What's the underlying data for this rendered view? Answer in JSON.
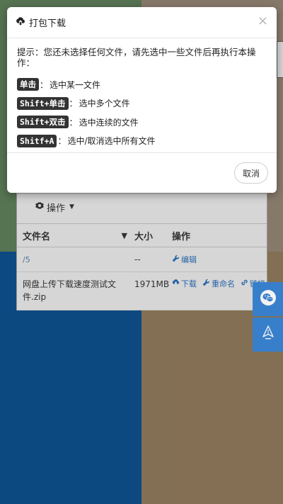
{
  "modal": {
    "title": "打包下载",
    "close_label": "×",
    "tip": "提示：您还未选择任何文件，请先选中一些文件后再执行本操作：",
    "shortcuts": [
      {
        "key": "单击",
        "desc": "选中某一文件"
      },
      {
        "key": "Shift+单击",
        "desc": "选中多个文件"
      },
      {
        "key": "Shift+双击",
        "desc": "选中连续的文件"
      },
      {
        "key": "Shitf+A",
        "desc": "选中/取消选中所有文件"
      }
    ],
    "cancel_label": "取消"
  },
  "panel": {
    "operation_label": "操作",
    "columns": {
      "name": "文件名",
      "size": "大小",
      "actions": "操作"
    },
    "rows": [
      {
        "name": "/5",
        "size": "--",
        "actions": {
          "edit": "编辑"
        }
      },
      {
        "name": "网盘上传下载速度测试文件.zip",
        "size": "1971MB",
        "actions": {
          "download": "下载",
          "rename": "重命名",
          "link": "链接"
        }
      }
    ]
  },
  "colors": {
    "accent_blue": "#3b86d6",
    "link_blue": "#2a6ab0",
    "kbd_bg": "#333333"
  },
  "icons": {
    "modal_title_icon": "cloud-download-icon",
    "operation_icon": "gear-icon",
    "side_top": "wechat-icon",
    "side_bottom": "back-to-top-icon"
  }
}
